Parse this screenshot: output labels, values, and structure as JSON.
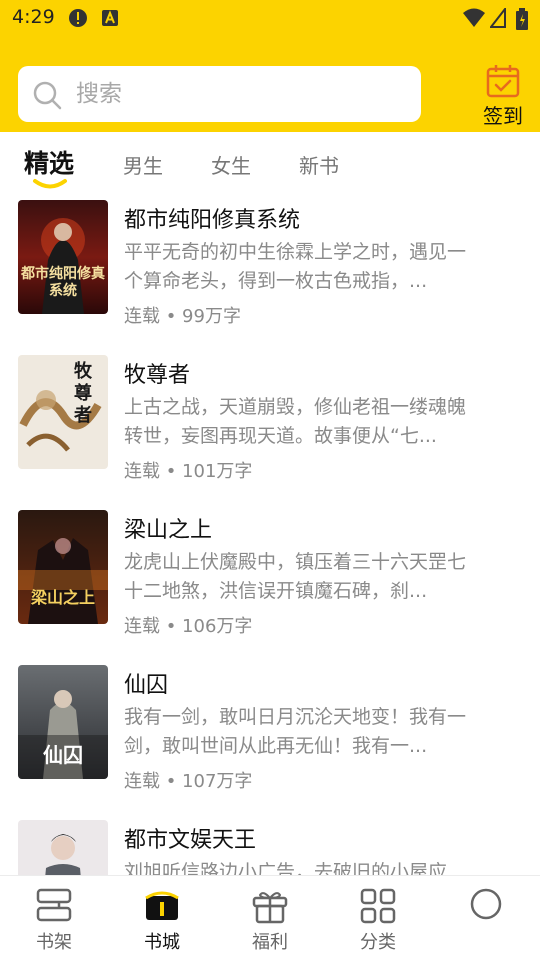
{
  "status_bar": {
    "time": "4:29"
  },
  "search": {
    "placeholder": "搜索"
  },
  "signin": {
    "label": "签到"
  },
  "tabs": [
    {
      "label": "精选",
      "active": true
    },
    {
      "label": "男生"
    },
    {
      "label": "女生"
    },
    {
      "label": "新书"
    }
  ],
  "books": [
    {
      "title": "都市纯阳修真系统",
      "description": "平平无奇的初中生徐霖上学之时，遇见一个算命老头，得到一枚古色戒指，...",
      "status": "连载",
      "word_count": "99万字",
      "meta": "连载 • 99万字",
      "cover_text": "都市纯阳修真系统"
    },
    {
      "title": "牧尊者",
      "description": "上古之战，天道崩毁，修仙老祖一缕魂魄转世，妄图再现天道。故事便从“七...",
      "status": "连载",
      "word_count": "101万字",
      "meta": "连载 • 101万字",
      "cover_text": "牧尊者"
    },
    {
      "title": "梁山之上",
      "description": "龙虎山上伏魔殿中，镇压着三十六天罡七十二地煞，洪信误开镇魔石碑，刹...",
      "status": "连载",
      "word_count": "106万字",
      "meta": "连载 • 106万字",
      "cover_text": "梁山之上"
    },
    {
      "title": "仙囚",
      "description": "我有一剑，敢叫日月沉沦天地变！我有一剑，敢叫世间从此再无仙！我有一...",
      "status": "连载",
      "word_count": "107万字",
      "meta": "连载 • 107万字",
      "cover_text": "仙囚"
    },
    {
      "title": "都市文娱天王",
      "description": "刘旭听信路边小广告，去破旧的小屋应...",
      "status": "",
      "word_count": "",
      "meta": "",
      "cover_text": ""
    }
  ],
  "bottom_nav": [
    {
      "label": "书架",
      "icon": "bookshelf-icon"
    },
    {
      "label": "书城",
      "icon": "bookstore-icon",
      "active": true
    },
    {
      "label": "福利",
      "icon": "gift-icon"
    },
    {
      "label": "分类",
      "icon": "category-icon"
    },
    {
      "label": "",
      "icon": "profile-icon"
    }
  ],
  "colors": {
    "accent": "#FCD300",
    "text_primary": "#111111",
    "text_secondary": "#8a8a8a"
  }
}
